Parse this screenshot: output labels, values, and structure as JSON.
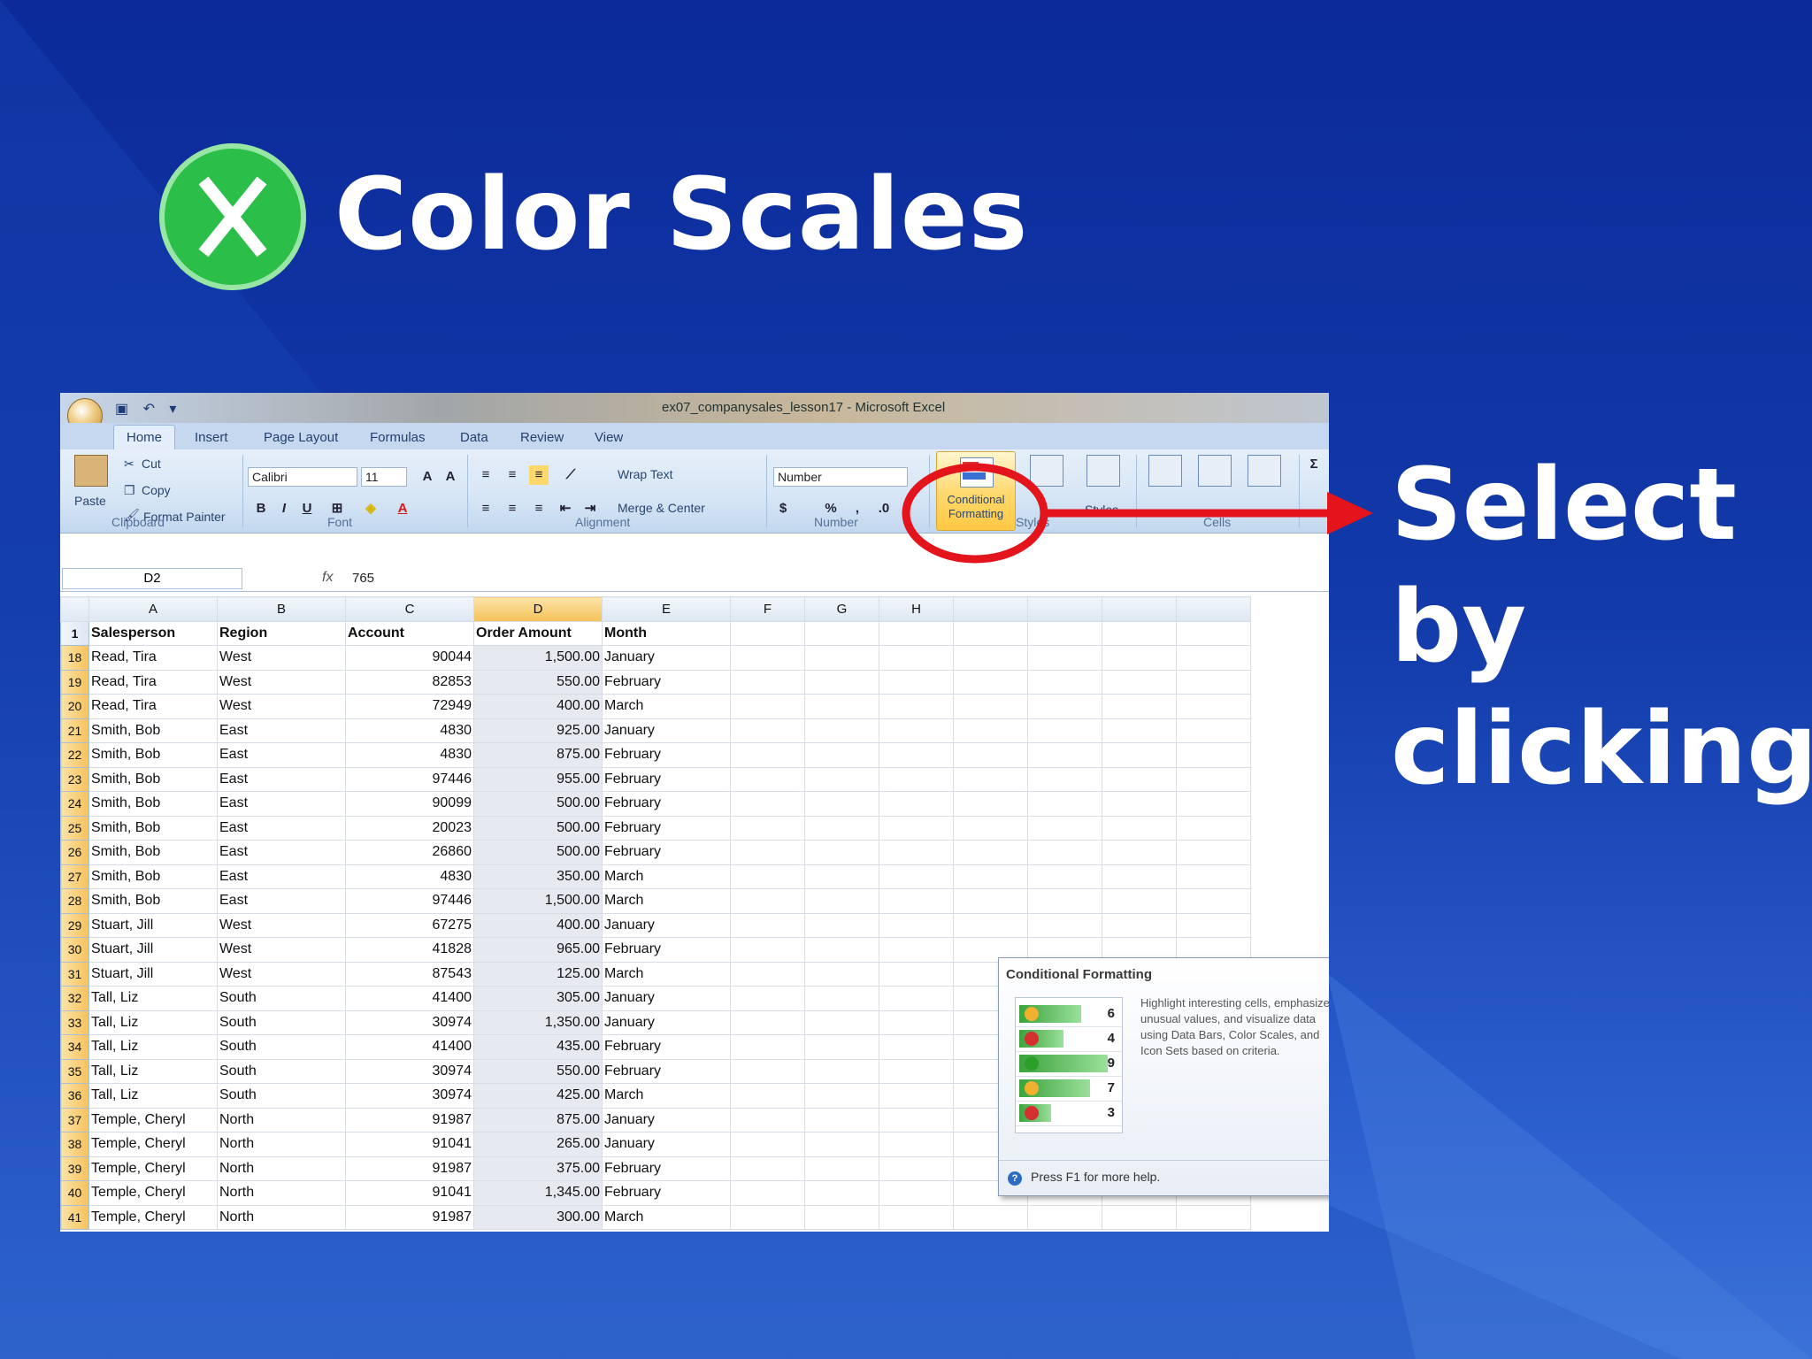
{
  "slide": {
    "title": "Color Scales",
    "note_lines": [
      "Select",
      "by",
      "clicking"
    ],
    "colors": {
      "accent_red": "#e3141b",
      "logo_green": "#2bbf4a"
    }
  },
  "excel": {
    "window_title": "ex07_companysales_lesson17 - Microsoft Excel",
    "tabs": [
      "Home",
      "Insert",
      "Page Layout",
      "Formulas",
      "Data",
      "Review",
      "View"
    ],
    "ribbon": {
      "clipboard": {
        "paste": "Paste",
        "cut": "Cut",
        "copy": "Copy",
        "format_painter": "Format Painter",
        "label": "Clipboard"
      },
      "font": {
        "name": "Calibri",
        "size": "11",
        "label": "Font",
        "bold": "B",
        "italic": "I",
        "underline": "U"
      },
      "alignment": {
        "wrap_text": "Wrap Text",
        "merge_center": "Merge & Center",
        "label": "Alignment"
      },
      "number": {
        "format": "Number",
        "label": "Number",
        "percent": "%"
      },
      "styles": {
        "conditional_formatting": "Conditional Formatting",
        "styles": "Styles",
        "label": "Styles"
      },
      "cells": {
        "label": "Cells"
      },
      "editing": {
        "sum": "Σ"
      }
    },
    "formula_bar": {
      "name_box": "D2",
      "fx": "fx",
      "value": "765"
    },
    "columns": [
      "A",
      "B",
      "C",
      "D",
      "E",
      "F",
      "G",
      "H"
    ],
    "header_row": {
      "num": "1",
      "cells": [
        "Salesperson",
        "Region",
        "Account",
        "Order Amount",
        "Month"
      ]
    },
    "rows": [
      {
        "num": "18",
        "cells": [
          "Read, Tira",
          "West",
          "90044",
          "1,500.00",
          "January"
        ]
      },
      {
        "num": "19",
        "cells": [
          "Read, Tira",
          "West",
          "82853",
          "550.00",
          "February"
        ]
      },
      {
        "num": "20",
        "cells": [
          "Read, Tira",
          "West",
          "72949",
          "400.00",
          "March"
        ]
      },
      {
        "num": "21",
        "cells": [
          "Smith, Bob",
          "East",
          "4830",
          "925.00",
          "January"
        ]
      },
      {
        "num": "22",
        "cells": [
          "Smith, Bob",
          "East",
          "4830",
          "875.00",
          "February"
        ]
      },
      {
        "num": "23",
        "cells": [
          "Smith, Bob",
          "East",
          "97446",
          "955.00",
          "February"
        ]
      },
      {
        "num": "24",
        "cells": [
          "Smith, Bob",
          "East",
          "90099",
          "500.00",
          "February"
        ]
      },
      {
        "num": "25",
        "cells": [
          "Smith, Bob",
          "East",
          "20023",
          "500.00",
          "February"
        ]
      },
      {
        "num": "26",
        "cells": [
          "Smith, Bob",
          "East",
          "26860",
          "500.00",
          "February"
        ]
      },
      {
        "num": "27",
        "cells": [
          "Smith, Bob",
          "East",
          "4830",
          "350.00",
          "March"
        ]
      },
      {
        "num": "28",
        "cells": [
          "Smith, Bob",
          "East",
          "97446",
          "1,500.00",
          "March"
        ]
      },
      {
        "num": "29",
        "cells": [
          "Stuart, Jill",
          "West",
          "67275",
          "400.00",
          "January"
        ]
      },
      {
        "num": "30",
        "cells": [
          "Stuart, Jill",
          "West",
          "41828",
          "965.00",
          "February"
        ]
      },
      {
        "num": "31",
        "cells": [
          "Stuart, Jill",
          "West",
          "87543",
          "125.00",
          "March"
        ]
      },
      {
        "num": "32",
        "cells": [
          "Tall, Liz",
          "South",
          "41400",
          "305.00",
          "January"
        ]
      },
      {
        "num": "33",
        "cells": [
          "Tall, Liz",
          "South",
          "30974",
          "1,350.00",
          "January"
        ]
      },
      {
        "num": "34",
        "cells": [
          "Tall, Liz",
          "South",
          "41400",
          "435.00",
          "February"
        ]
      },
      {
        "num": "35",
        "cells": [
          "Tall, Liz",
          "South",
          "30974",
          "550.00",
          "February"
        ]
      },
      {
        "num": "36",
        "cells": [
          "Tall, Liz",
          "South",
          "30974",
          "425.00",
          "March"
        ]
      },
      {
        "num": "37",
        "cells": [
          "Temple, Cheryl",
          "North",
          "91987",
          "875.00",
          "January"
        ]
      },
      {
        "num": "38",
        "cells": [
          "Temple, Cheryl",
          "North",
          "91041",
          "265.00",
          "January"
        ]
      },
      {
        "num": "39",
        "cells": [
          "Temple, Cheryl",
          "North",
          "91987",
          "375.00",
          "February"
        ]
      },
      {
        "num": "40",
        "cells": [
          "Temple, Cheryl",
          "North",
          "91041",
          "1,345.00",
          "February"
        ]
      },
      {
        "num": "41",
        "cells": [
          "Temple, Cheryl",
          "North",
          "91987",
          "300.00",
          "March"
        ]
      }
    ],
    "tooltip": {
      "title": "Conditional Formatting",
      "body": "Highlight interesting cells, emphasize unusual values, and visualize data using Data Bars, Color Scales, and Icon Sets based on criteria.",
      "footer": "Press F1 for more help.",
      "sample_values": [
        "6",
        "4",
        "9",
        "7",
        "3"
      ]
    }
  }
}
